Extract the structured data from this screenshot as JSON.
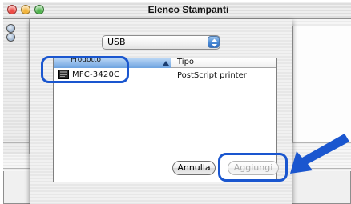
{
  "window": {
    "title": "Elenco Stampanti"
  },
  "connection_popup": {
    "selected": "USB"
  },
  "printer_table": {
    "columns": [
      "Prodotto",
      "Tipo"
    ],
    "rows": [
      {
        "product": "MFC-3420C",
        "type": "PostScript printer"
      }
    ]
  },
  "buttons": {
    "cancel_label": "Annulla",
    "add_label": "Aggiungi"
  },
  "colors": {
    "annotation_blue": "#1a56cf",
    "selection_blue": "#6da3e0"
  },
  "icons": {
    "close": "close-icon",
    "minimize": "minimize-icon",
    "zoom": "zoom-icon",
    "popup_arrows": "chevron-updown-icon",
    "sort": "sort-ascending-icon",
    "printer": "printer-icon",
    "pointer": "arrow-pointer-icon"
  }
}
